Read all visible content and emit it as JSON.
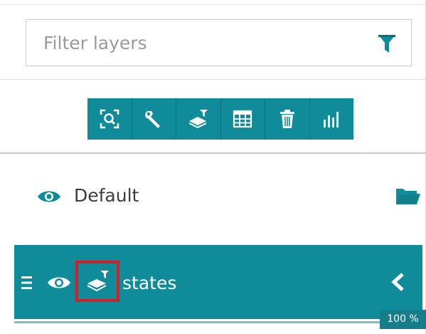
{
  "filter": {
    "placeholder": "Filter layers",
    "value": "",
    "icon": "filter-icon"
  },
  "toolbar": {
    "background": "#0f8b99",
    "tools": [
      {
        "icon": "zoom-to-extent-icon"
      },
      {
        "icon": "wrench-icon"
      },
      {
        "icon": "layer-style-icon"
      },
      {
        "icon": "attribute-table-icon"
      },
      {
        "icon": "trash-icon"
      },
      {
        "icon": "bar-chart-icon"
      }
    ]
  },
  "layer_group": {
    "label": "Default",
    "visible": true,
    "icon": "folder-open-icon"
  },
  "selected_layer": {
    "label": "states",
    "visible": true,
    "highlight_color": "#d0202a",
    "row_color": "#0f8b99"
  },
  "status": {
    "zoom": "100 %"
  }
}
